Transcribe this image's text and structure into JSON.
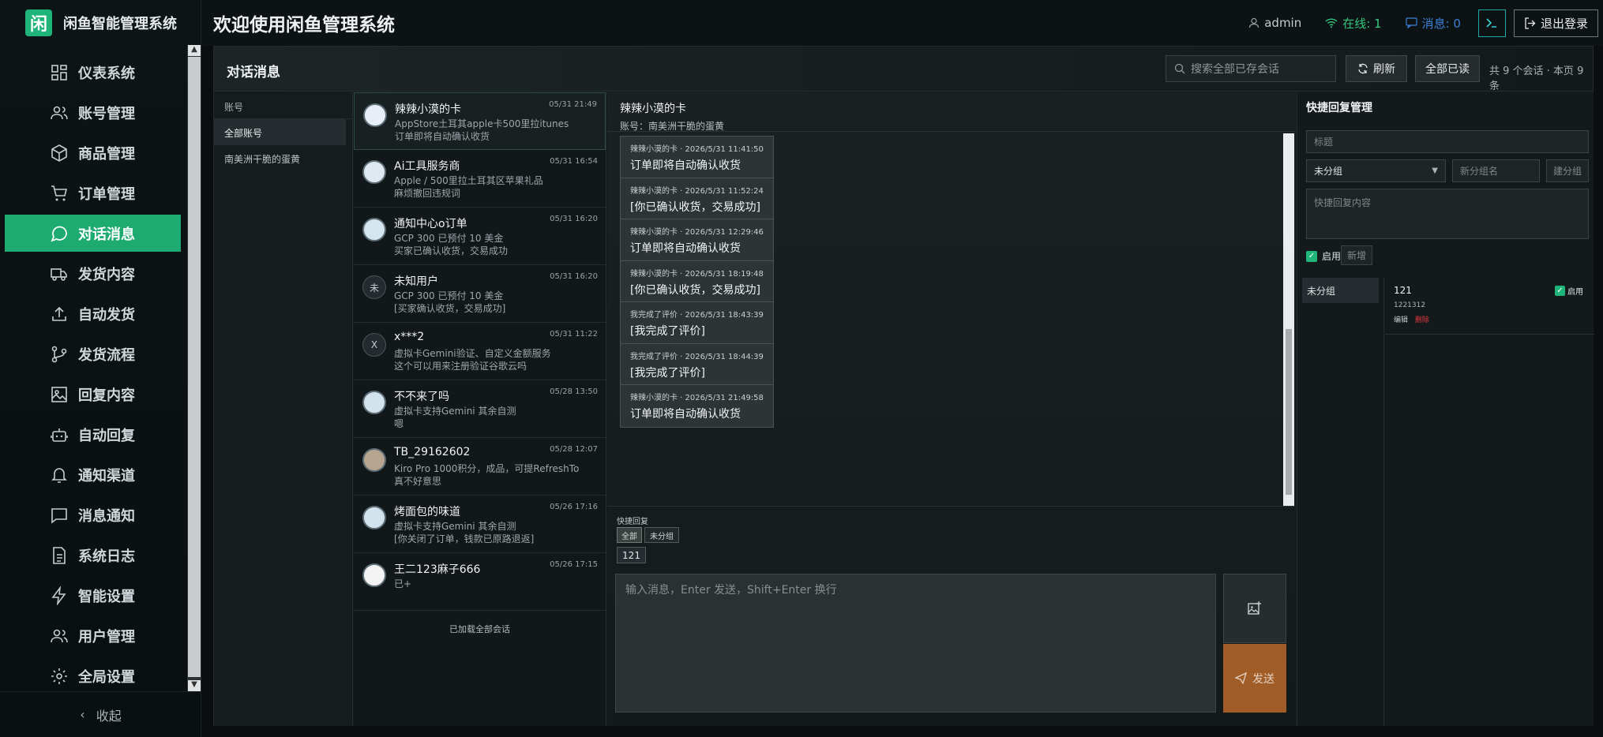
{
  "brand": {
    "logo_char": "闲",
    "name": "闲鱼智能管理系统"
  },
  "nav": [
    {
      "label": "仪表系统",
      "icon": "dashboard-icon"
    },
    {
      "label": "账号管理",
      "icon": "users-icon"
    },
    {
      "label": "商品管理",
      "icon": "package-icon"
    },
    {
      "label": "订单管理",
      "icon": "cart-icon"
    },
    {
      "label": "对话消息",
      "icon": "chat-icon",
      "active": true
    },
    {
      "label": "发货内容",
      "icon": "truck-icon"
    },
    {
      "label": "自动发货",
      "icon": "upload-icon"
    },
    {
      "label": "发货流程",
      "icon": "flow-icon"
    },
    {
      "label": "回复内容",
      "icon": "image-icon"
    },
    {
      "label": "自动回复",
      "icon": "bot-icon"
    },
    {
      "label": "通知渠道",
      "icon": "bell-icon"
    },
    {
      "label": "消息通知",
      "icon": "message-icon"
    },
    {
      "label": "系统日志",
      "icon": "file-icon"
    },
    {
      "label": "智能设置",
      "icon": "bolt-icon"
    },
    {
      "label": "用户管理",
      "icon": "user-group-icon"
    },
    {
      "label": "全局设置",
      "icon": "gear-icon"
    }
  ],
  "collapse_label": "收起",
  "header": {
    "title": "欢迎使用闲鱼管理系统",
    "user": "admin",
    "online": "在线: 1",
    "messages": "消息: 0",
    "logout": "退出登录"
  },
  "main": {
    "title": "对话消息",
    "search_placeholder": "搜索全部已存会话",
    "refresh": "刷新",
    "mark_all_read": "全部已读",
    "counter": "共 9 个会话 · 本页 9 条"
  },
  "accounts": {
    "header": "账号",
    "items": [
      "全部账号",
      "南美洲干脆的蛋黄"
    ]
  },
  "conversations": [
    {
      "name": "辣辣小漠的卡",
      "time": "05/31 21:49",
      "l1": "AppStore土耳其apple卡500里拉itunes",
      "l2": "订单即将自动确认收货"
    },
    {
      "name": "Ai工具服务商",
      "time": "05/31 16:54",
      "l1": "Apple / 500里拉土耳其区苹果礼品",
      "l2": "麻烦撤回违规词"
    },
    {
      "name": "通知中心o订单",
      "time": "05/31 16:20",
      "l1": "GCP 300 已预付 10 美金",
      "l2": "买家已确认收货，交易成功"
    },
    {
      "name": "未知用户",
      "time": "05/31 16:20",
      "l1": "GCP 300 已预付 10 美金",
      "l2": "[买家确认收货，交易成功]",
      "avatar_text": "未"
    },
    {
      "name": "x***2",
      "time": "05/31 11:22",
      "l1": "虚拟卡Gemini验证、自定义金额服务",
      "l2": "这个可以用来注册验证谷歌云吗",
      "avatar_text": "X"
    },
    {
      "name": "不不来了吗",
      "time": "05/28 13:50",
      "l1": "虚拟卡支持Gemini 其余自测",
      "l2": "嗯"
    },
    {
      "name": "TB_29162602",
      "time": "05/28 12:07",
      "l1": "Kiro Pro 1000积分，成品，可提RefreshTo",
      "l2": "真不好意思"
    },
    {
      "name": "烤面包的味道",
      "time": "05/26 17:16",
      "l1": "虚拟卡支持Gemini 其余自测",
      "l2": "[你关闭了订单，钱款已原路退返]"
    },
    {
      "name": "王二123麻子666",
      "time": "05/26 17:15",
      "l1": "已+",
      "l2": ""
    }
  ],
  "loaded_all": "已加载全部会话",
  "chat": {
    "name": "辣辣小漠的卡",
    "account": "账号：南美洲干脆的蛋黄",
    "messages": [
      {
        "meta": "辣辣小漠的卡 · 2026/5/31 11:41:50",
        "text": "订单即将自动确认收货"
      },
      {
        "meta": "辣辣小漠的卡 · 2026/5/31 11:52:24",
        "text": "[你已确认收货，交易成功]"
      },
      {
        "meta": "辣辣小漠的卡 · 2026/5/31 12:29:46",
        "text": "订单即将自动确认收货"
      },
      {
        "meta": "辣辣小漠的卡 · 2026/5/31 18:19:48",
        "text": "[你已确认收货，交易成功]"
      },
      {
        "meta": "我完成了评价 · 2026/5/31 18:43:39",
        "text": "[我完成了评价]"
      },
      {
        "meta": "我完成了评价 · 2026/5/31 18:44:39",
        "text": "[我完成了评价]"
      },
      {
        "meta": "辣辣小漠的卡 · 2026/5/31 21:49:58",
        "text": "订单即将自动确认收货"
      }
    ],
    "quick_reply_label": "快捷回复",
    "chips": [
      "全部",
      "未分组"
    ],
    "quick_item": "121",
    "input_placeholder": "输入消息，Enter 发送，Shift+Enter 换行",
    "send": "发送"
  },
  "quick_mgmt": {
    "title": "快捷回复管理",
    "title_placeholder": "标题",
    "group_select": "未分组",
    "new_group_placeholder": "新分组名",
    "create_group": "建分组",
    "content_placeholder": "快捷回复内容",
    "enable": "启用",
    "add": "新增",
    "groups": [
      "未分组"
    ],
    "item": {
      "title": "121",
      "content": "1221312",
      "edit": "编辑",
      "delete": "删除",
      "enabled": "启用"
    }
  }
}
